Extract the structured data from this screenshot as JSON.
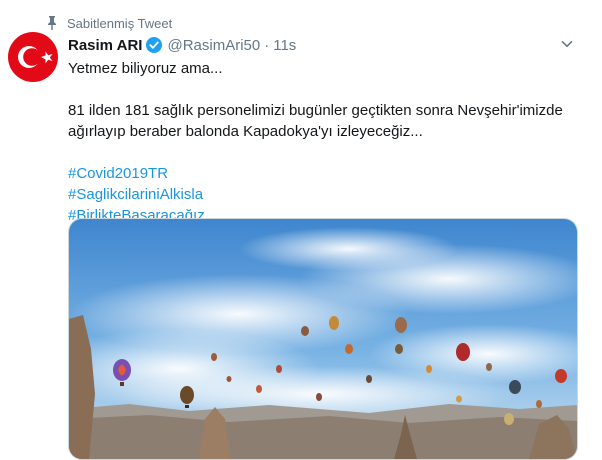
{
  "pinned": {
    "label": "Sabitlenmiş Tweet",
    "icon": "pin-icon"
  },
  "author": {
    "name": "Rasim ARI",
    "handle": "@RasimAri50",
    "separator": "·",
    "time": "11s",
    "verified": true,
    "avatar": "turkish-flag-avatar"
  },
  "tweet": {
    "line1": "Yetmez biliyoruz ama...",
    "line2": "81 ilden 181 sağlık personelimizi bugünler geçtikten sonra Nevşehir'imizde ağırlayıp beraber balonda Kapadokya'yı izleyeceğiz...",
    "hashtags": [
      "#Covid2019TR",
      "#SaglikcilariniAlkisla",
      "#BirlikteBaşaracağız"
    ]
  },
  "media": {
    "description_icon": "photo-cappadocia-balloons"
  },
  "colors": {
    "accent": "#1b95e0",
    "verified": "#1da1f2",
    "secondary_text": "#657786",
    "flag_red": "#e30a17"
  }
}
